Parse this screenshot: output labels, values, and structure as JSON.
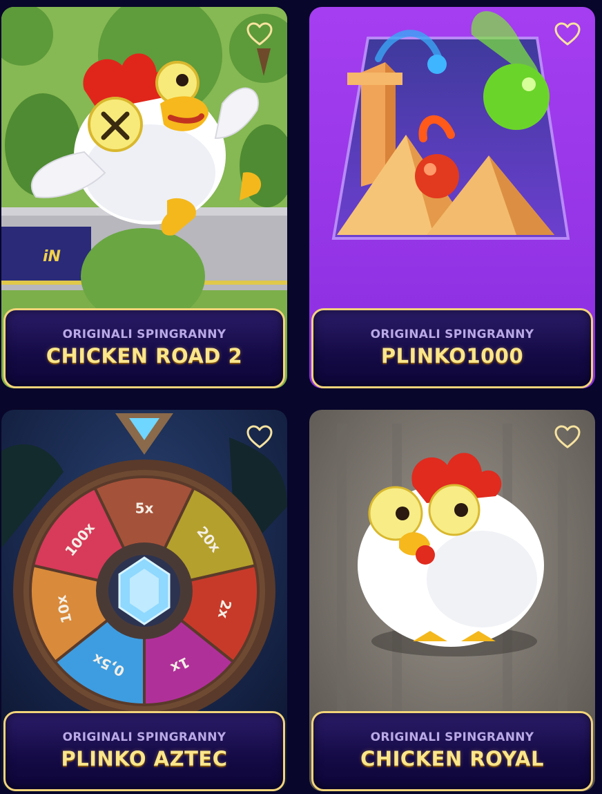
{
  "colors": {
    "page_background": "#08062a",
    "label_border": "#f2d47a",
    "provider_text": "#b9a9e6",
    "title_text": "#fbe68a",
    "favorite_icon": "#f7e3a0"
  },
  "games": [
    {
      "provider": "ORIGINALI SPINGRANNY",
      "title": "CHICKEN ROAD 2",
      "art_icon": "chicken-road-2-art",
      "favorite_icon": "heart-outline-icon"
    },
    {
      "provider": "ORIGINALI SPINGRANNY",
      "title": "PLINKO1000",
      "art_icon": "plinko1000-art",
      "favorite_icon": "heart-outline-icon"
    },
    {
      "provider": "ORIGINALI SPINGRANNY",
      "title": "PLINKO AZTEC",
      "art_icon": "plinko-aztec-wheel-art",
      "wheel_segments": [
        "5x",
        "20x",
        "2x",
        "1x",
        "0,5x",
        "10x",
        "100x"
      ],
      "favorite_icon": "heart-outline-icon"
    },
    {
      "provider": "ORIGINALI SPINGRANNY",
      "title": "CHICKEN ROYAL",
      "art_icon": "chicken-royal-art",
      "favorite_icon": "heart-outline-icon"
    }
  ]
}
